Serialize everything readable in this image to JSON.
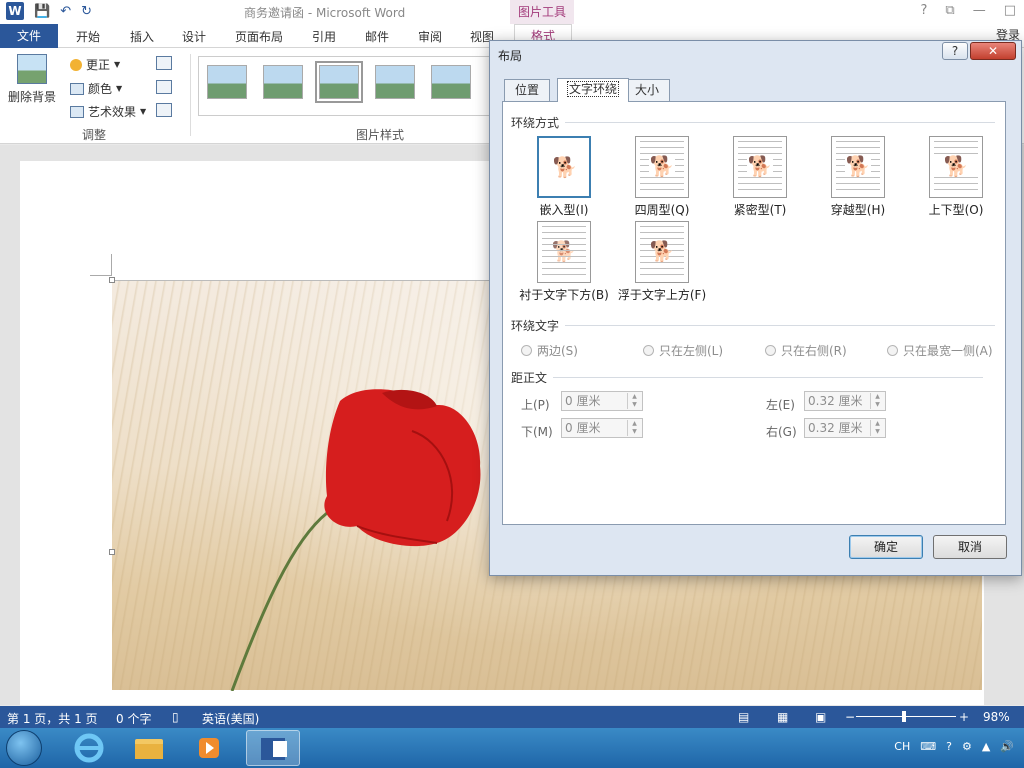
{
  "window": {
    "title": "商务邀请函 - Microsoft Word",
    "tools_tab": "图片工具",
    "login": "登录"
  },
  "qat": {
    "word_logo": "W",
    "save": "💾",
    "undo": "↶",
    "redo": "↻"
  },
  "window_controls": {
    "help": "?",
    "restore": "⧉",
    "minimize": "—",
    "maximize": "□"
  },
  "ribbon_tabs": {
    "file": "文件",
    "home": "开始",
    "insert": "插入",
    "design": "设计",
    "layout": "页面布局",
    "references": "引用",
    "mailings": "邮件",
    "review": "审阅",
    "view": "视图",
    "format": "格式"
  },
  "ribbon": {
    "remove_background": "删除背景",
    "corrections": "更正",
    "color": "颜色",
    "artistic_effects": "艺术效果",
    "adjust_group": "调整",
    "picture_styles_group": "图片样式"
  },
  "dialog": {
    "title": "布局",
    "help": "?",
    "close": "✕",
    "tabs": {
      "position": "位置",
      "text_wrapping": "文字环绕",
      "size": "大小"
    },
    "wrap_style_section": "环绕方式",
    "wrap_options": {
      "inline": "嵌入型(I)",
      "square": "四周型(Q)",
      "tight": "紧密型(T)",
      "through": "穿越型(H)",
      "top_bottom": "上下型(O)",
      "behind": "衬于文字下方(B)",
      "in_front": "浮于文字上方(F)"
    },
    "wrap_text_section": "环绕文字",
    "wrap_text_options": {
      "both": "两边(S)",
      "left_only": "只在左侧(L)",
      "right_only": "只在右侧(R)",
      "largest_only": "只在最宽一侧(A)"
    },
    "distance_section": "距正文",
    "distance": {
      "top_label": "上(P)",
      "top_value": "0 厘米",
      "bottom_label": "下(M)",
      "bottom_value": "0 厘米",
      "left_label": "左(E)",
      "left_value": "0.32 厘米",
      "right_label": "右(G)",
      "right_value": "0.32 厘米"
    },
    "ok": "确定",
    "cancel": "取消"
  },
  "status": {
    "page": "第 1 页，共 1 页",
    "words": "0 个字",
    "language": "英语(美国)",
    "zoom": "98%"
  },
  "tray": {
    "input_lang": "CH"
  }
}
